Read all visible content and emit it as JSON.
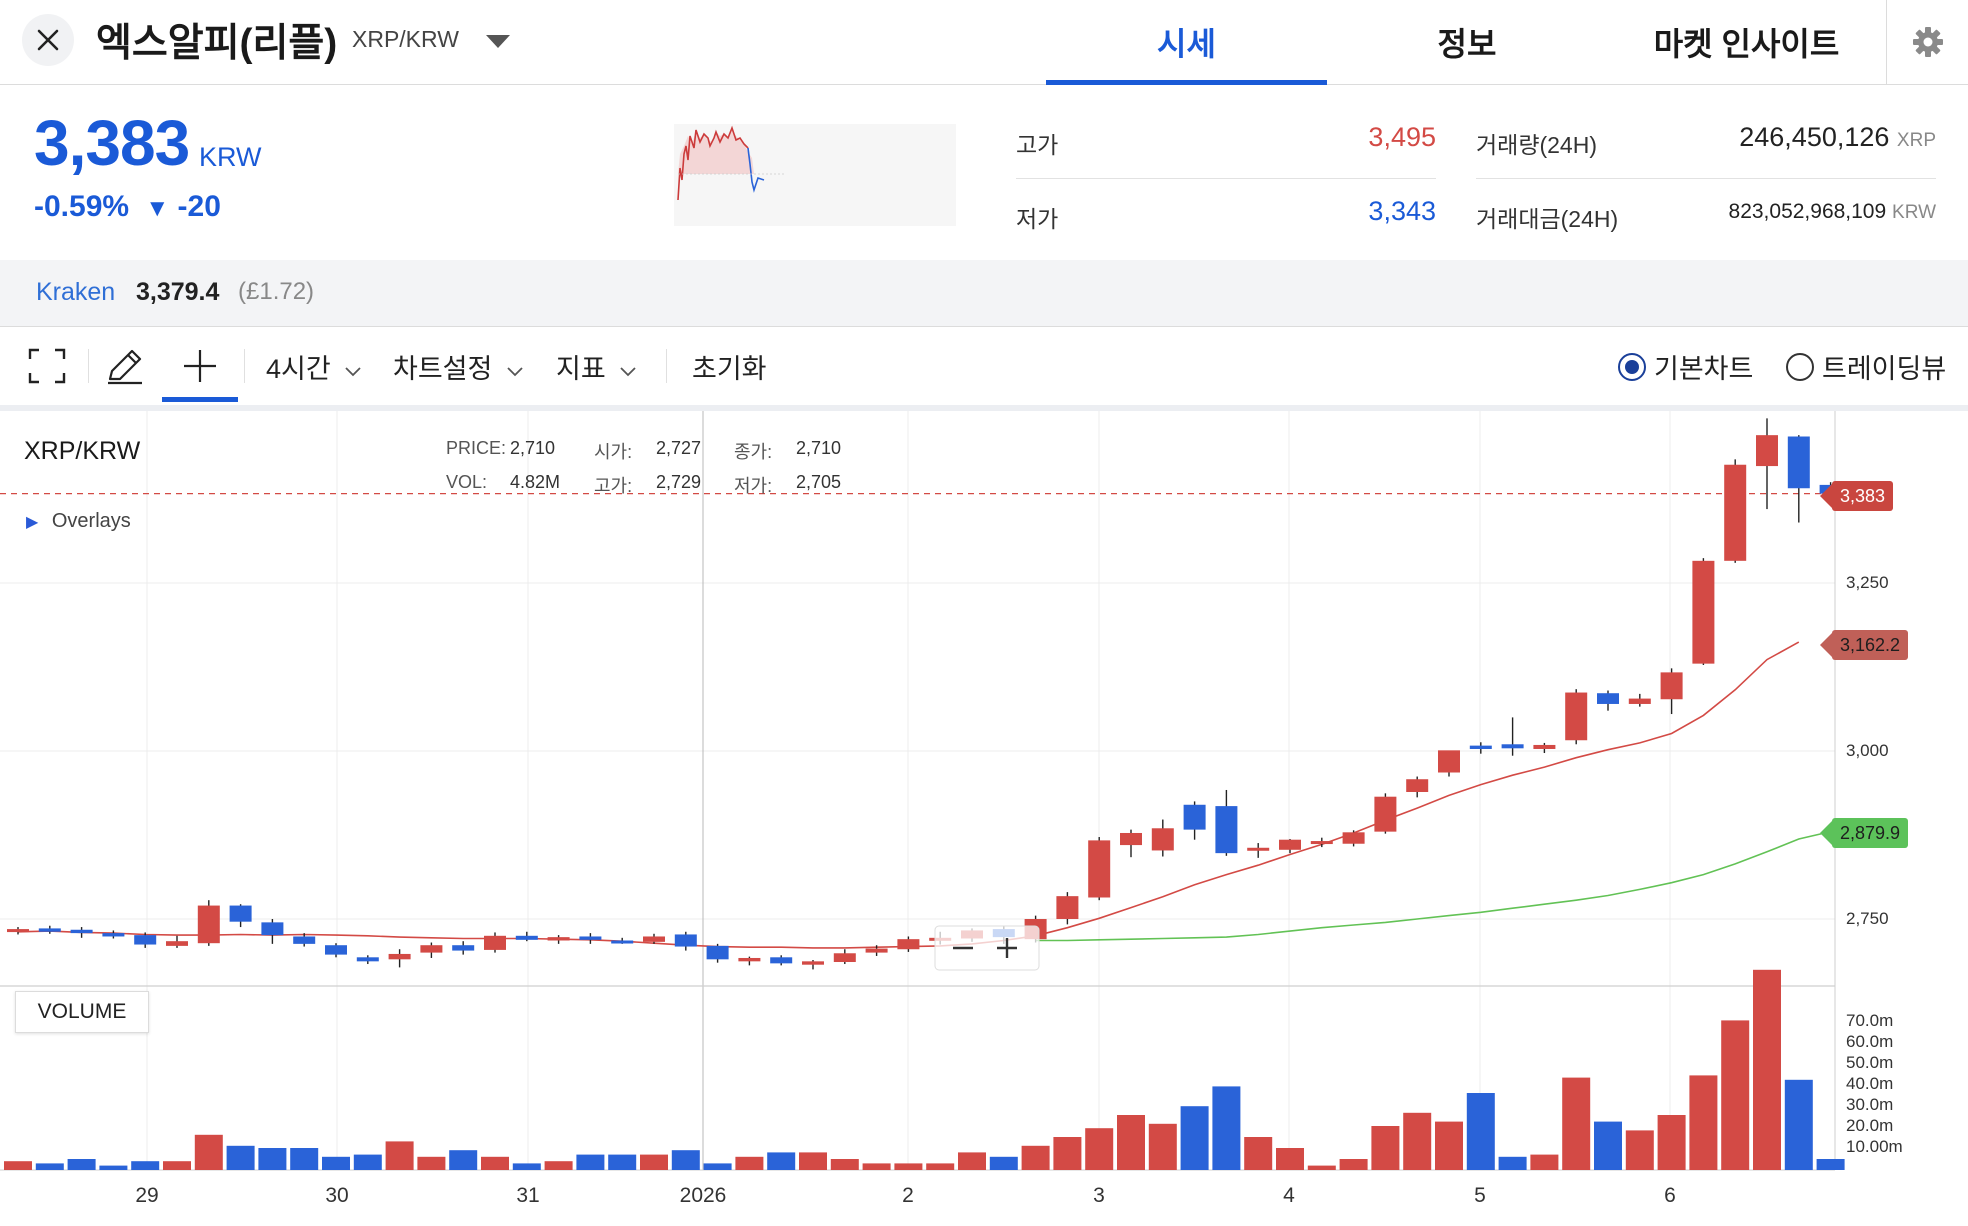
{
  "header": {
    "coin_name": "엑스알피(리플)",
    "pair": "XRP/KRW",
    "tabs": [
      {
        "label": "시세",
        "active": true
      },
      {
        "label": "정보",
        "active": false
      },
      {
        "label": "마켓 인사이트",
        "active": false
      }
    ],
    "icons": {
      "close": "close-icon",
      "dropdown": "chevron-down-icon",
      "settings": "gear-icon"
    }
  },
  "summary": {
    "price": "3,383",
    "unit": "KRW",
    "change_pct": "-0.59%",
    "change_arrow": "▼",
    "change_abs": "-20",
    "high_label": "고가",
    "high_value": "3,495",
    "low_label": "저가",
    "low_value": "3,343",
    "volume_label": "거래량(24H)",
    "volume_value": "246,450,126",
    "volume_unit": "XRP",
    "amount_label": "거래대금(24H)",
    "amount_value": "823,052,968,109",
    "amount_unit": "KRW"
  },
  "exchange": {
    "name": "Kraken",
    "price": "3,379.4",
    "gbp": "(£1.72)"
  },
  "toolbar": {
    "interval": "4시간",
    "chart_settings": "차트설정",
    "indicators": "지표",
    "reset": "초기화",
    "radio_basic": "기본차트",
    "radio_tradingview": "트레이딩뷰",
    "selected_radio": "기본차트"
  },
  "legend": {
    "symbol": "XRP/KRW",
    "overlays": "Overlays",
    "price_key": "PRICE:",
    "price_val": "2,710",
    "open_key": "시가:",
    "open_val": "2,727",
    "close_key": "종가:",
    "close_val": "2,710",
    "vol_key": "VOL:",
    "vol_val": "4.82M",
    "high_key": "고가:",
    "high_val": "2,729",
    "low_key": "저가:",
    "low_val": "2,705",
    "volume_title": "VOLUME"
  },
  "price_tags": {
    "last": "3,383",
    "ma_short": "3,162.2",
    "ma_long": "2,879.9"
  },
  "colors": {
    "up": "#d34a45",
    "down": "#2a63d8",
    "accent": "#1a5ad7",
    "ma_short": "#d34a45",
    "ma_long": "#62c255"
  },
  "chart_data": {
    "type": "candlestick",
    "interval": "4시간",
    "x_labels": [
      "29",
      "30",
      "31",
      "2026",
      "2",
      "3",
      "4",
      "5",
      "6"
    ],
    "y_ticks": [
      "3,250",
      "3,000",
      "2,750"
    ],
    "volume_ticks": [
      "70.0m",
      "60.0m",
      "50.0m",
      "40.0m",
      "30.0m",
      "20.0m",
      "10.00m"
    ],
    "ylim": [
      2620,
      3510
    ],
    "volume_max": 80,
    "grid": true,
    "candles": [
      {
        "o": 2733,
        "h": 2738,
        "l": 2727,
        "c": 2735,
        "v": 4
      },
      {
        "o": 2736,
        "h": 2740,
        "l": 2728,
        "c": 2731,
        "v": 3
      },
      {
        "o": 2734,
        "h": 2738,
        "l": 2722,
        "c": 2729,
        "v": 5
      },
      {
        "o": 2729,
        "h": 2733,
        "l": 2721,
        "c": 2724,
        "v": 2
      },
      {
        "o": 2726,
        "h": 2730,
        "l": 2707,
        "c": 2712,
        "v": 4
      },
      {
        "o": 2710,
        "h": 2725,
        "l": 2707,
        "c": 2717,
        "v": 4
      },
      {
        "o": 2714,
        "h": 2778,
        "l": 2710,
        "c": 2770,
        "v": 16
      },
      {
        "o": 2770,
        "h": 2772,
        "l": 2738,
        "c": 2746,
        "v": 11
      },
      {
        "o": 2745,
        "h": 2750,
        "l": 2713,
        "c": 2726,
        "v": 10
      },
      {
        "o": 2724,
        "h": 2729,
        "l": 2709,
        "c": 2713,
        "v": 10
      },
      {
        "o": 2711,
        "h": 2714,
        "l": 2693,
        "c": 2697,
        "v": 6
      },
      {
        "o": 2693,
        "h": 2696,
        "l": 2683,
        "c": 2687,
        "v": 7
      },
      {
        "o": 2690,
        "h": 2705,
        "l": 2678,
        "c": 2698,
        "v": 13
      },
      {
        "o": 2700,
        "h": 2715,
        "l": 2692,
        "c": 2711,
        "v": 6
      },
      {
        "o": 2711,
        "h": 2717,
        "l": 2697,
        "c": 2703,
        "v": 9
      },
      {
        "o": 2704,
        "h": 2730,
        "l": 2700,
        "c": 2725,
        "v": 6
      },
      {
        "o": 2725,
        "h": 2731,
        "l": 2717,
        "c": 2719,
        "v": 3
      },
      {
        "o": 2718,
        "h": 2726,
        "l": 2713,
        "c": 2723,
        "v": 4
      },
      {
        "o": 2724,
        "h": 2729,
        "l": 2713,
        "c": 2719,
        "v": 7
      },
      {
        "o": 2718,
        "h": 2722,
        "l": 2713,
        "c": 2715,
        "v": 7
      },
      {
        "o": 2716,
        "h": 2728,
        "l": 2713,
        "c": 2724,
        "v": 7
      },
      {
        "o": 2727,
        "h": 2731,
        "l": 2703,
        "c": 2709,
        "v": 9
      },
      {
        "o": 2710,
        "h": 2713,
        "l": 2685,
        "c": 2690,
        "v": 3
      },
      {
        "o": 2687,
        "h": 2694,
        "l": 2681,
        "c": 2692,
        "v": 6
      },
      {
        "o": 2693,
        "h": 2696,
        "l": 2681,
        "c": 2684,
        "v": 8
      },
      {
        "o": 2682,
        "h": 2689,
        "l": 2675,
        "c": 2687,
        "v": 8
      },
      {
        "o": 2686,
        "h": 2705,
        "l": 2683,
        "c": 2699,
        "v": 5
      },
      {
        "o": 2700,
        "h": 2711,
        "l": 2695,
        "c": 2706,
        "v": 3
      },
      {
        "o": 2705,
        "h": 2724,
        "l": 2701,
        "c": 2720,
        "v": 3
      },
      {
        "o": 2718,
        "h": 2731,
        "l": 2712,
        "c": 2722,
        "v": 3
      },
      {
        "o": 2721,
        "h": 2736,
        "l": 2716,
        "c": 2733,
        "v": 8
      },
      {
        "o": 2735,
        "h": 2740,
        "l": 2713,
        "c": 2723,
        "v": 6
      },
      {
        "o": 2720,
        "h": 2755,
        "l": 2715,
        "c": 2750,
        "v": 11
      },
      {
        "o": 2750,
        "h": 2790,
        "l": 2742,
        "c": 2784,
        "v": 15
      },
      {
        "o": 2782,
        "h": 2872,
        "l": 2778,
        "c": 2867,
        "v": 19
      },
      {
        "o": 2860,
        "h": 2883,
        "l": 2842,
        "c": 2878,
        "v": 25
      },
      {
        "o": 2852,
        "h": 2898,
        "l": 2843,
        "c": 2885,
        "v": 21
      },
      {
        "o": 2920,
        "h": 2925,
        "l": 2868,
        "c": 2883,
        "v": 29
      },
      {
        "o": 2918,
        "h": 2942,
        "l": 2844,
        "c": 2848,
        "v": 38
      },
      {
        "o": 2852,
        "h": 2863,
        "l": 2841,
        "c": 2856,
        "v": 15
      },
      {
        "o": 2853,
        "h": 2869,
        "l": 2848,
        "c": 2868,
        "v": 10
      },
      {
        "o": 2862,
        "h": 2871,
        "l": 2857,
        "c": 2866,
        "v": 2
      },
      {
        "o": 2862,
        "h": 2882,
        "l": 2858,
        "c": 2879,
        "v": 5
      },
      {
        "o": 2880,
        "h": 2937,
        "l": 2877,
        "c": 2932,
        "v": 20
      },
      {
        "o": 2939,
        "h": 2962,
        "l": 2931,
        "c": 2958,
        "v": 26
      },
      {
        "o": 2968,
        "h": 3000,
        "l": 2962,
        "c": 3001,
        "v": 22
      },
      {
        "o": 3008,
        "h": 3013,
        "l": 2996,
        "c": 3003,
        "v": 35
      },
      {
        "o": 3010,
        "h": 3050,
        "l": 2993,
        "c": 3004,
        "v": 6
      },
      {
        "o": 3003,
        "h": 3012,
        "l": 2997,
        "c": 3009,
        "v": 7
      },
      {
        "o": 3016,
        "h": 3092,
        "l": 3010,
        "c": 3087,
        "v": 42
      },
      {
        "o": 3086,
        "h": 3090,
        "l": 3060,
        "c": 3070,
        "v": 22
      },
      {
        "o": 3070,
        "h": 3085,
        "l": 3066,
        "c": 3078,
        "v": 18
      },
      {
        "o": 3077,
        "h": 3123,
        "l": 3055,
        "c": 3117,
        "v": 25
      },
      {
        "o": 3130,
        "h": 3287,
        "l": 3128,
        "c": 3283,
        "v": 43
      },
      {
        "o": 3283,
        "h": 3434,
        "l": 3280,
        "c": 3426,
        "v": 68
      },
      {
        "o": 3424,
        "h": 3495,
        "l": 3360,
        "c": 3470,
        "v": 91
      },
      {
        "o": 3468,
        "h": 3470,
        "l": 3340,
        "c": 3391,
        "v": 41
      },
      {
        "o": 3396,
        "h": 3400,
        "l": 3380,
        "c": 3383,
        "v": 5
      }
    ],
    "ma_short_values": [
      2731,
      2732,
      2730,
      2729,
      2727,
      2726,
      2726,
      2727,
      2726,
      2727,
      2726,
      2725,
      2723,
      2722,
      2721,
      2721,
      2721,
      2720,
      2719,
      2717,
      2714,
      2711,
      2709,
      2708,
      2708,
      2707,
      2707,
      2708,
      2709,
      2710,
      2713,
      2718,
      2725,
      2737,
      2751,
      2767,
      2783,
      2801,
      2816,
      2830,
      2846,
      2861,
      2878,
      2897,
      2915,
      2934,
      2950,
      2964,
      2976,
      2990,
      3002,
      3012,
      3026,
      3053,
      3091,
      3136,
      3162
    ],
    "ma_long_values": [
      2718,
      2718,
      2719,
      2720,
      2721,
      2722,
      2723,
      2727,
      2732,
      2737,
      2741,
      2745,
      2750,
      2755,
      2760,
      2766,
      2772,
      2778,
      2785,
      2794,
      2804,
      2816,
      2832,
      2850,
      2869,
      2880
    ]
  }
}
